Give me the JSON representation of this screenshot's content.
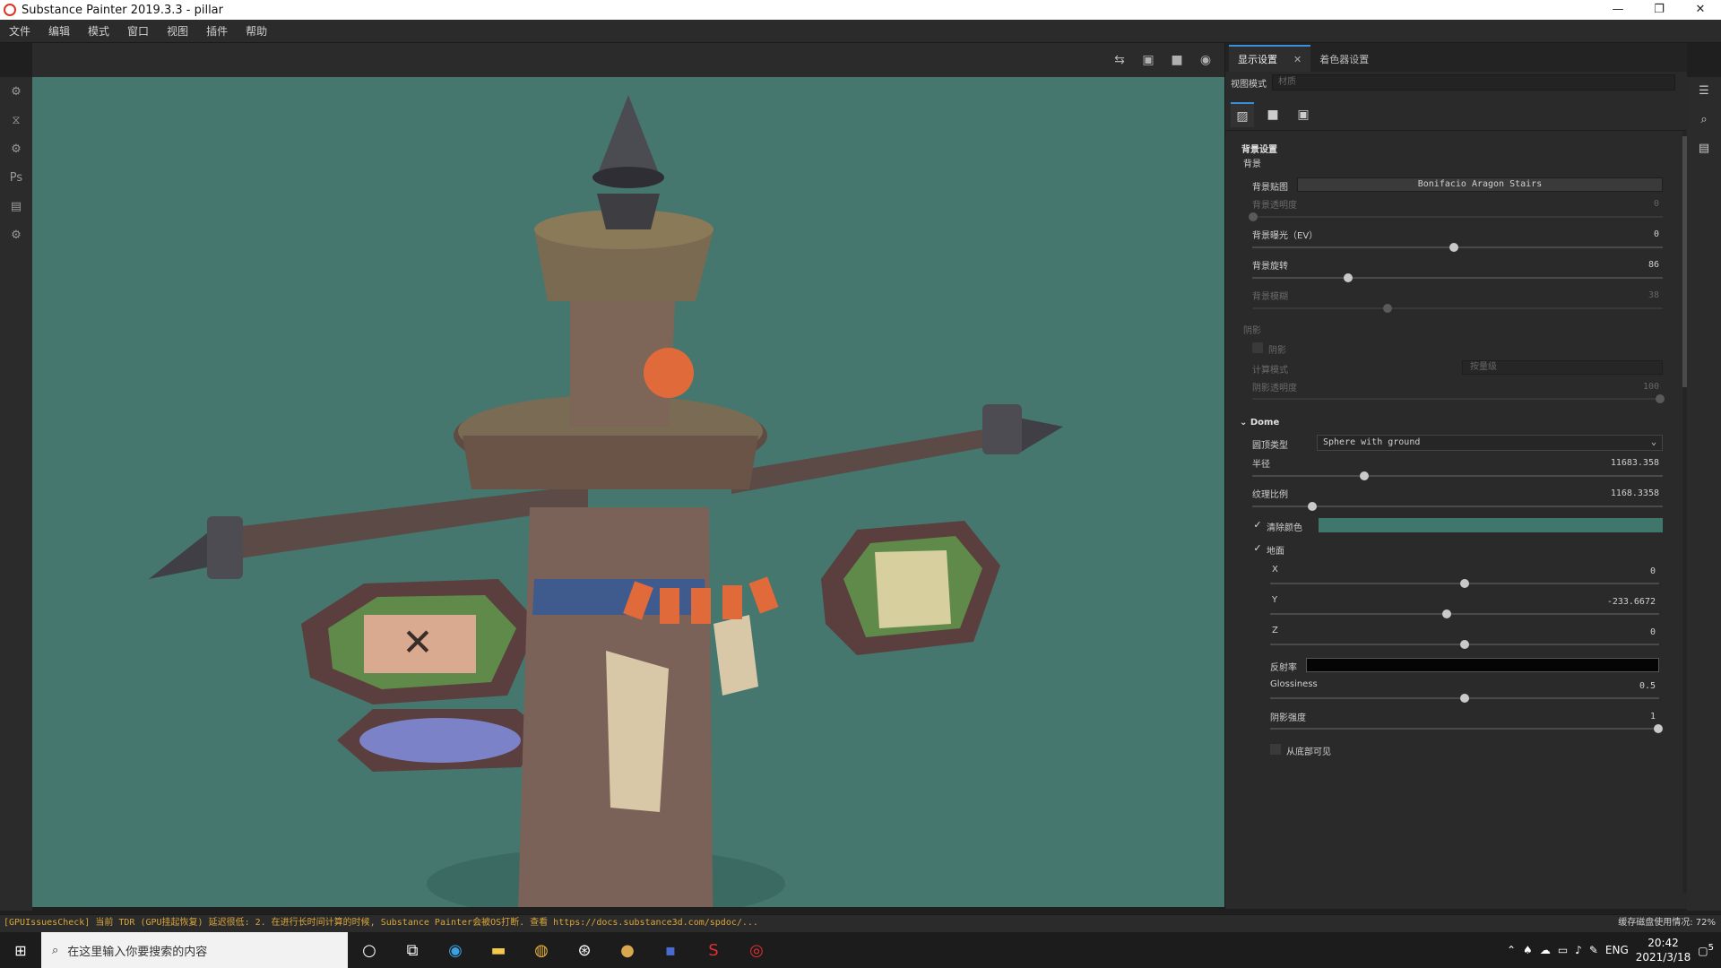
{
  "window": {
    "title": "Substance Painter 2019.3.3 - pillar",
    "min": "—",
    "restore": "❐",
    "close": "✕"
  },
  "menu": [
    "文件",
    "编辑",
    "模式",
    "窗口",
    "视图",
    "插件",
    "帮助"
  ],
  "left_toolbar": [
    "⚙",
    "⧖",
    "⚙",
    "Ps",
    "▤",
    "⚙"
  ],
  "viewport_icons": [
    "⇆",
    "▣",
    "■",
    "◉"
  ],
  "panel": {
    "tabs": [
      {
        "label": "显示设置",
        "close": "✕"
      },
      {
        "label": "着色器设置"
      }
    ],
    "view_mode_label": "视图模式",
    "view_mode_value": "材质",
    "icons": [
      "▨",
      "■",
      "▣"
    ],
    "bg_section_title": "背景设置",
    "bg_sub": "背景",
    "bg_map_label": "背景贴图",
    "bg_map_value": "Bonifacio Aragon Stairs",
    "bg_opacity_label": "背景透明度",
    "bg_opacity_value": "0",
    "bg_exposure_label": "背景曝光（EV）",
    "bg_exposure_value": "0",
    "bg_rotation_label": "背景旋转",
    "bg_rotation_value": "86",
    "bg_blur_label": "背景模糊",
    "bg_blur_value": "38",
    "shadow_section": "阴影",
    "shadow_check_label": "阴影",
    "calc_mode_label": "计算模式",
    "calc_mode_value": "按量级",
    "shadow_opacity_label": "阴影透明度",
    "shadow_opacity_value": "100",
    "dome_title": "Dome",
    "dome_type_label": "圆顶类型",
    "dome_type_value": "Sphere with ground",
    "radius_label": "半径",
    "radius_value": "11683.358",
    "texture_scale_label": "纹理比例",
    "texture_scale_value": "1168.3358",
    "clear_color_label": "清除颜色",
    "ground_label": "地面",
    "x_label": "X",
    "x_value": "0",
    "y_label": "Y",
    "y_value": "-233.6672",
    "z_label": "Z",
    "z_value": "0",
    "reflect_label": "反射率",
    "gloss_label": "Glossiness",
    "gloss_value": "0.5",
    "shadow_strength_label": "阴影强度",
    "shadow_strength_value": "1",
    "visible_below_label": "从底部可见",
    "clear_color": "#3f776d"
  },
  "right_strip": [
    "☰",
    "⌕",
    "▤"
  ],
  "status": {
    "message": "[GPUIssuesCheck] 当前 TDR (GPU挂起恢复) 延迟很低: 2. 在进行长时间计算的时候, Substance Painter会被OS打断. 查看 https://docs.substance3d.com/spdoc/...",
    "disk": "缓存磁盘使用情况:  72%"
  },
  "taskbar": {
    "search_placeholder": "在这里输入你要搜索的内容",
    "lang": "ENG",
    "time": "20:42",
    "date": "2021/3/18",
    "notif": "5"
  },
  "colors": {
    "viewport_bg": "#45776e",
    "accent": "#3b8fd9"
  }
}
